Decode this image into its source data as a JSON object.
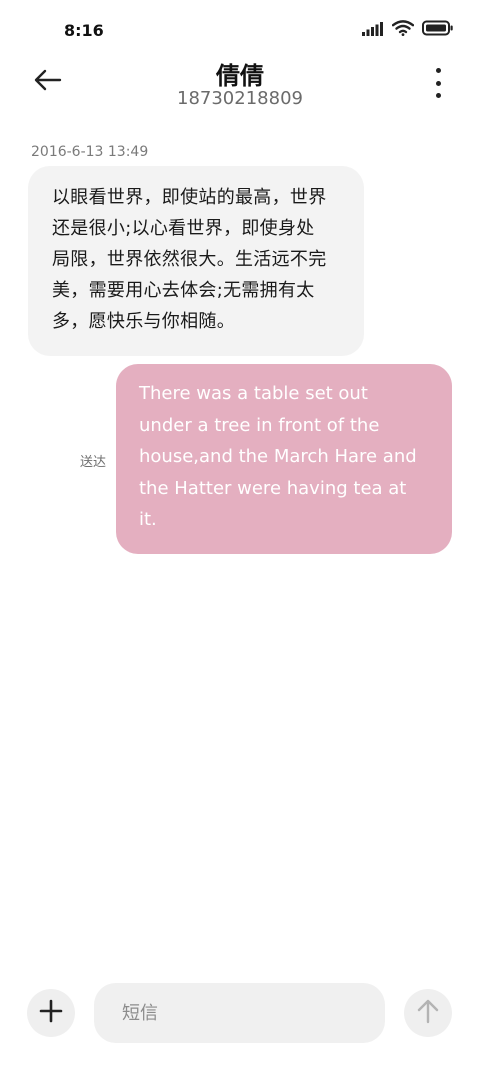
{
  "status_bar": {
    "time": "8:16",
    "icons": [
      "signal-icon",
      "wifi-icon",
      "battery-icon"
    ]
  },
  "header": {
    "contact_name": "倩倩",
    "contact_number": "18730218809",
    "back_icon": "back-arrow-icon",
    "more_icon": "more-vertical-icon"
  },
  "conversation": {
    "timestamp": "2016-6-13 13:49",
    "incoming_message": {
      "lines": [
        "以眼看世界，即使站的最高，世界",
        "还是很小;以心看世界，即使身处",
        "局限，世界依然很大。生活远不完",
        "美，需要用心去体会;无需拥有太",
        "多，愿快乐与你相随。"
      ]
    },
    "outgoing_message": {
      "lines": [
        "There was a table set out",
        "under a tree in front of the",
        "house,and the March Hare and",
        "the Hatter were having tea at",
        "it."
      ],
      "status": "送达",
      "bubble_color": "#e4afc0"
    }
  },
  "compose": {
    "placeholder": "短信",
    "add_icon": "plus-icon",
    "send_icon": "send-arrow-up-icon"
  }
}
